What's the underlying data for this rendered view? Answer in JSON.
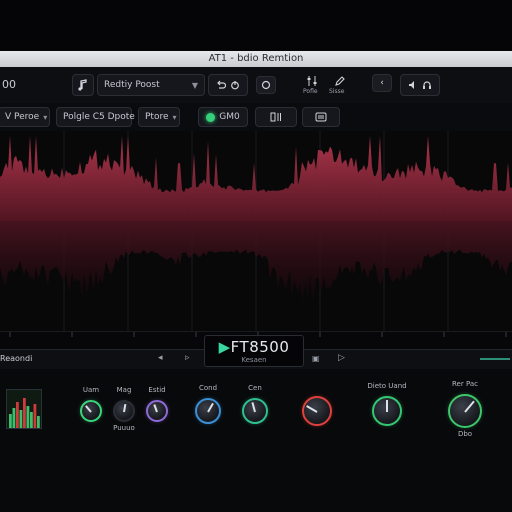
{
  "window": {
    "title": "AT1 - bdio Remtion"
  },
  "toolbar": {
    "counter": "00",
    "preset_label": "Redtiy Poost",
    "undo_icon": "undo-icon",
    "power_icon": "power-icon",
    "record_icon": "record-icon",
    "cap_a": "Pofle",
    "cap_b": "Sisse"
  },
  "controls": {
    "mode_label": "V Peroe",
    "source_label": "Polgle C5 Dpote",
    "sub_label": "Ptore",
    "monitor_label": "GM0"
  },
  "waveform": {
    "color_top": "#8a2a3c",
    "color_bottom": "#3c1018",
    "ruler_marks": [
      "0",
      "1",
      "2",
      "3",
      "4",
      "5",
      "6",
      "7",
      "8"
    ]
  },
  "transport": {
    "section_label": "Reaondi",
    "readout_main": "FT8500",
    "readout_sub": "Kesaen"
  },
  "mixer": {
    "knobs": [
      {
        "label": "Uam",
        "sub": "",
        "ring": "#3bd57c"
      },
      {
        "label": "Mag",
        "sub": "Puuuo",
        "ring": "#2b2e36"
      },
      {
        "label": "Estid",
        "sub": "",
        "ring": "#8f6bd8"
      },
      {
        "label": "Cond",
        "sub": "",
        "ring": "#3a8fd6"
      },
      {
        "label": "Cen",
        "sub": "",
        "ring": "#2fbf8f"
      },
      {
        "label": "",
        "sub": "",
        "ring": "#e0413c"
      },
      {
        "label": "Dieto Uand",
        "sub": "",
        "ring": "#35c873"
      },
      {
        "label": "Rer Pac",
        "sub": "Dbo",
        "ring": "#3dc76a"
      }
    ]
  }
}
